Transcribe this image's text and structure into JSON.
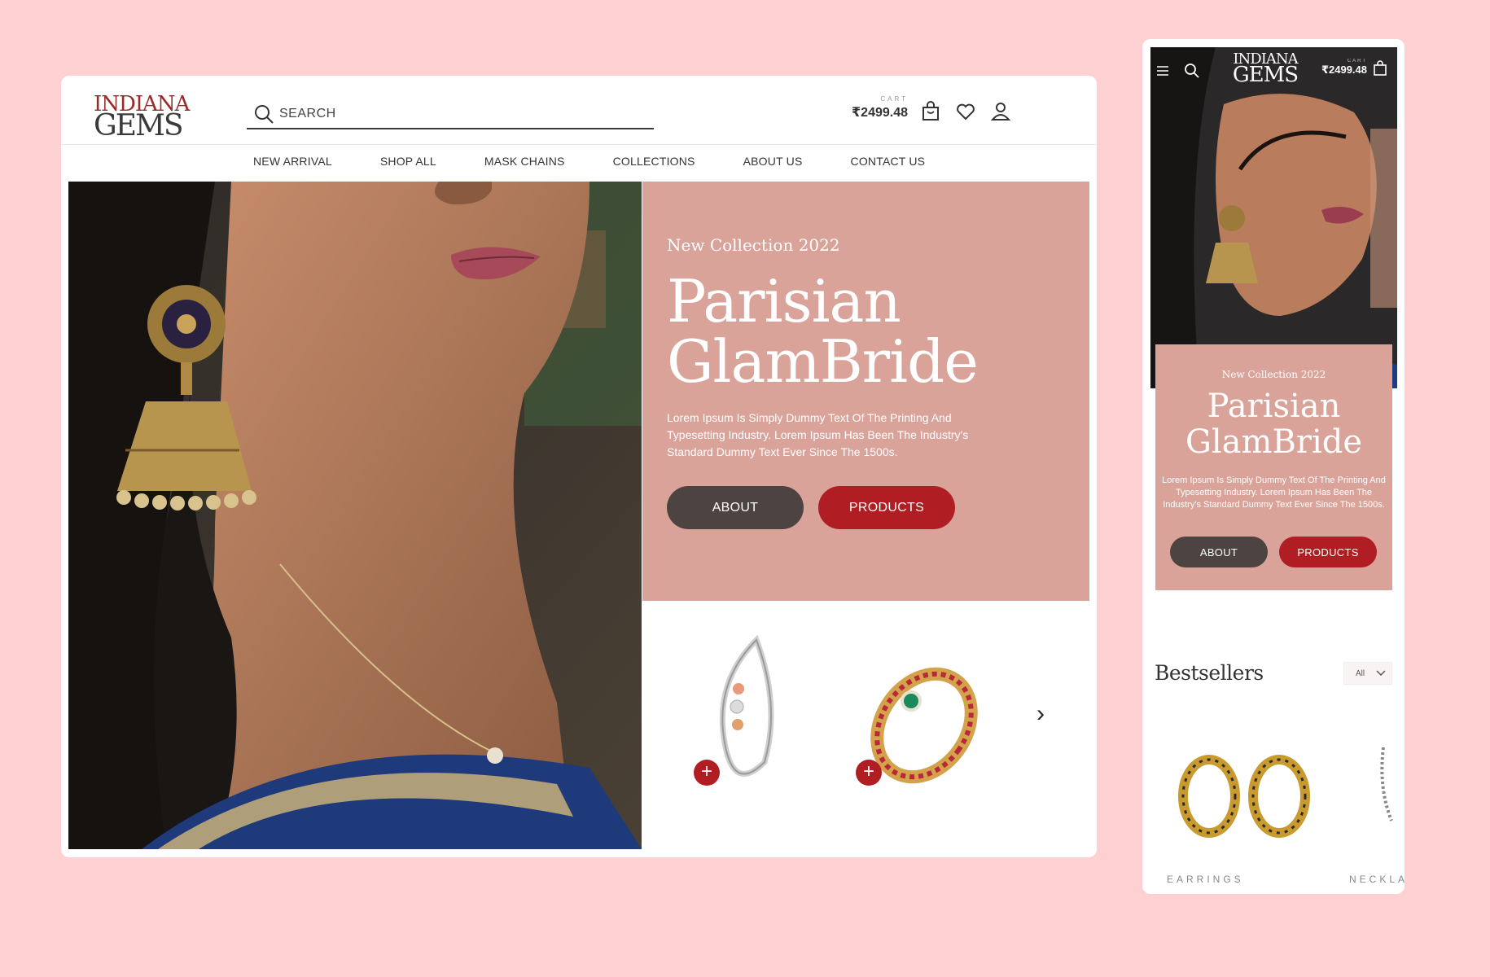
{
  "brand": {
    "line1": "INDIANA",
    "line2": "GEMS"
  },
  "search": {
    "placeholder": "SEARCH"
  },
  "cart": {
    "label": "CART",
    "value": "₹2499.48"
  },
  "nav": [
    "NEW ARRIVAL",
    "SHOP ALL",
    "MASK CHAINS",
    "COLLECTIONS",
    "ABOUT US",
    "CONTACT US"
  ],
  "hero": {
    "subtitle": "New Collection 2022",
    "title_line1": "Parisian",
    "title_line2": "GlamBride",
    "description": "Lorem Ipsum Is Simply Dummy Text Of The Printing And Typesetting Industry. Lorem Ipsum Has Been The Industry's Standard Dummy Text Ever Since The 1500s.",
    "about_label": "ABOUT",
    "products_label": "PRODUCTS"
  },
  "products": {
    "add_symbol": "+",
    "next_symbol": "›"
  },
  "mobile": {
    "bestsellers_title": "Bestsellers",
    "filter_value": "All",
    "categories": [
      "EARRINGS",
      "NECKLA"
    ]
  },
  "colors": {
    "background": "#fdd1d1",
    "panel": "#d9a39a",
    "accent": "#b01e24",
    "dark_button": "#4d4340"
  }
}
